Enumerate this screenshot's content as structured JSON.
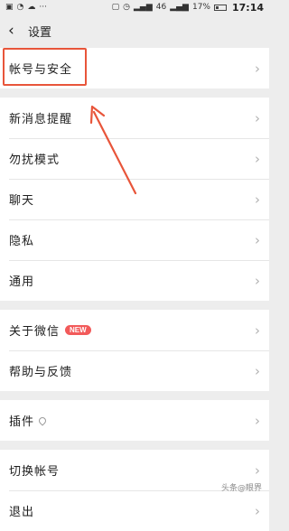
{
  "status_bar": {
    "icons": [
      "image-icon",
      "alarm-icon",
      "cloud-icon",
      "more-icon",
      "sim-icon",
      "clock-icon",
      "signal-icon",
      "signal-4g-icon",
      "battery-icon"
    ],
    "network_label": "46",
    "battery_percent": "17%",
    "time": "17:14"
  },
  "nav": {
    "title": "设置"
  },
  "groups": [
    {
      "items": [
        {
          "label": "帐号与安全"
        }
      ]
    },
    {
      "items": [
        {
          "label": "新消息提醒"
        },
        {
          "label": "勿扰模式"
        },
        {
          "label": "聊天"
        },
        {
          "label": "隐私"
        },
        {
          "label": "通用"
        }
      ]
    },
    {
      "items": [
        {
          "label": "关于微信",
          "badge": "NEW"
        },
        {
          "label": "帮助与反馈"
        }
      ]
    },
    {
      "items": [
        {
          "label": "插件",
          "icon": "location-pin-icon"
        }
      ]
    },
    {
      "items": [
        {
          "label": "切换帐号"
        },
        {
          "label": "退出"
        }
      ]
    }
  ],
  "annotation": {
    "color": "#e8553a"
  },
  "watermark": "头条@眼界"
}
